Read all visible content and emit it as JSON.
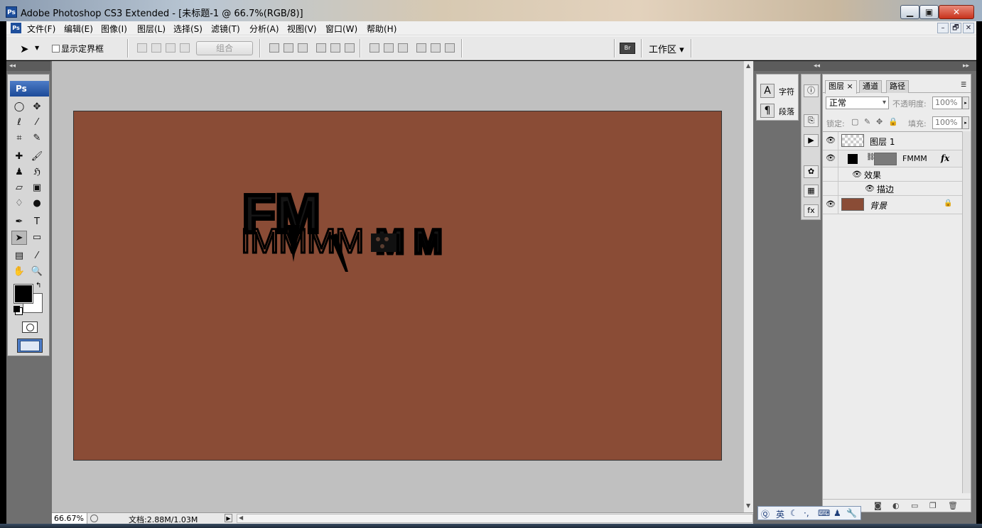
{
  "window": {
    "title": "Adobe Photoshop CS3 Extended - [未标题-1 @ 66.7%(RGB/8)]",
    "app_icon": "Ps",
    "controls": {
      "minimize": "▁",
      "maximize": "▣",
      "close": "✕"
    }
  },
  "menubar": {
    "items": [
      "文件(F)",
      "编辑(E)",
      "图像(I)",
      "图层(L)",
      "选择(S)",
      "滤镜(T)",
      "分析(A)",
      "视图(V)",
      "窗口(W)",
      "帮助(H)"
    ],
    "mdi_controls": [
      "–",
      "🗗",
      "✕"
    ]
  },
  "options_bar": {
    "show_bounds_label": "显示定界框",
    "group_button": "组合",
    "workspace_label": "工作区 ▾",
    "bridge_label": "Br"
  },
  "toolbox": {
    "badge": "Ps",
    "tools": [
      "marquee-icon",
      "move-icon",
      "lasso-icon",
      "magic-wand-icon",
      "crop-icon",
      "slice-icon",
      "healing-icon",
      "brush-icon",
      "stamp-icon",
      "history-brush-icon",
      "eraser-icon",
      "gradient-icon",
      "blur-icon",
      "dodge-icon",
      "pen-icon",
      "type-icon",
      "path-select-icon",
      "shape-icon",
      "notes-icon",
      "eyedropper-icon",
      "hand-icon",
      "zoom-icon"
    ],
    "foreground_color": "#000000",
    "background_color": "#ffffff"
  },
  "canvas": {
    "background_color": "#8a4c36",
    "text_large": "FM",
    "text_row": "IMMMM",
    "text_bold": "M M"
  },
  "statusbar": {
    "zoom": "66.67%",
    "doc_size": "文档:2.88M/1.03M"
  },
  "char_panel": {
    "character_label": "字符",
    "paragraph_label": "段落"
  },
  "layers_panel": {
    "tabs": [
      "图层 ×",
      "通道",
      "路径"
    ],
    "blend_mode": "正常",
    "opacity_label": "不透明度:",
    "opacity_value": "100%",
    "lock_label": "锁定:",
    "fill_label": "填充:",
    "fill_value": "100%",
    "layers": [
      {
        "name": "图层 1",
        "thumb": "transparent"
      },
      {
        "name": "FMMM",
        "thumb": "text",
        "fx": "fx"
      },
      {
        "name": "效果",
        "sub": true
      },
      {
        "name": "描边",
        "sub": true
      },
      {
        "name": "背景",
        "thumb": "#8a4c36",
        "locked": true
      }
    ]
  },
  "ime_bar": {
    "language": "英"
  }
}
